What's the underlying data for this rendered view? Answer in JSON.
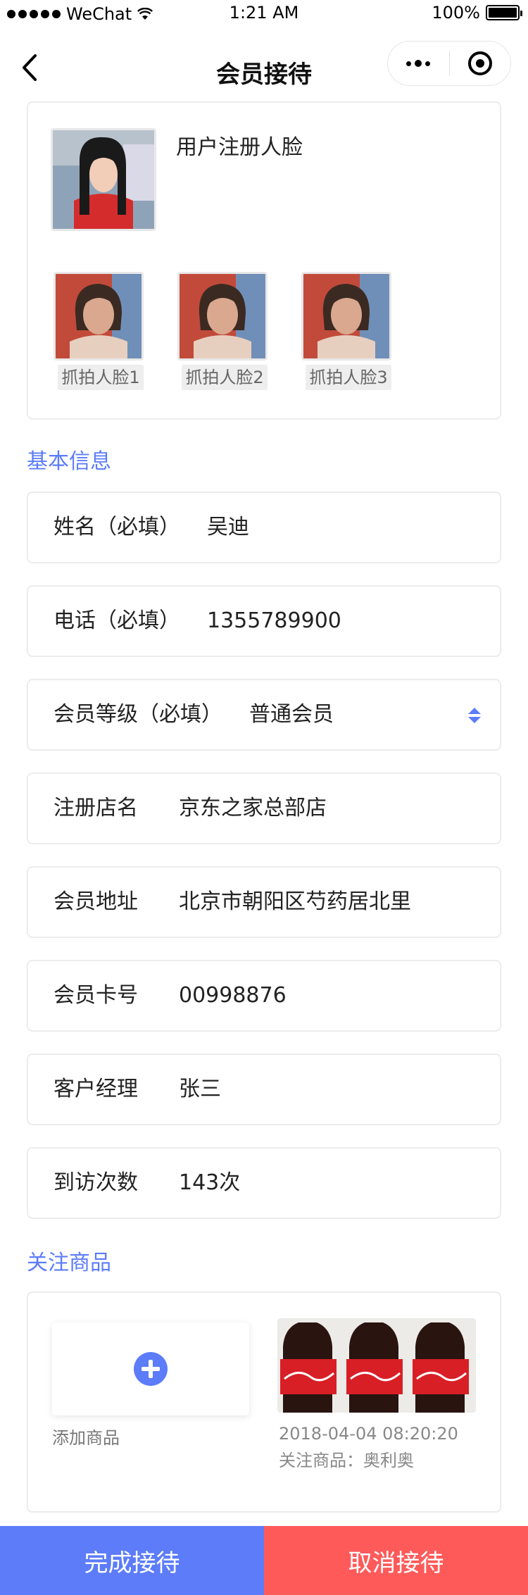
{
  "status_bar": {
    "carrier": "WeChat",
    "time": "1:21 AM",
    "battery_text": "100%",
    "battery_level": 1.0
  },
  "nav": {
    "title": "会员接待",
    "back_icon": "chevron-left-icon",
    "more_icon": "more-dots-icon",
    "close_icon": "target-circle-icon"
  },
  "faces": {
    "registered_label": "用户注册人脸",
    "snapshots": [
      {
        "label": "抓拍人脸1"
      },
      {
        "label": "抓拍人脸2"
      },
      {
        "label": "抓拍人脸3"
      }
    ]
  },
  "basic_info": {
    "section_title": "基本信息",
    "name": {
      "label": "姓名（必填）",
      "value": "吴迪"
    },
    "phone": {
      "label": "电话（必填）",
      "value": "1355789900"
    },
    "level": {
      "label": "会员等级（必填）",
      "value": "普通会员"
    },
    "store": {
      "label": "注册店名",
      "value": "京东之家总部店"
    },
    "address": {
      "label": "会员地址",
      "value": "北京市朝阳区芍药居北里"
    },
    "card_no": {
      "label": "会员卡号",
      "value": "00998876"
    },
    "manager": {
      "label": "客户经理",
      "value": "张三"
    },
    "visits": {
      "label": "到访次数",
      "value": "143次"
    }
  },
  "products": {
    "section_title": "关注商品",
    "add_label": "添加商品",
    "items": [
      {
        "date": "2018-04-04 08:20:20",
        "name": "关注商品：奥利奥"
      }
    ]
  },
  "actions": {
    "complete": "完成接待",
    "cancel": "取消接待"
  },
  "colors": {
    "accent": "#5c7cfa",
    "danger": "#ff5a5a",
    "border": "#ececec"
  }
}
